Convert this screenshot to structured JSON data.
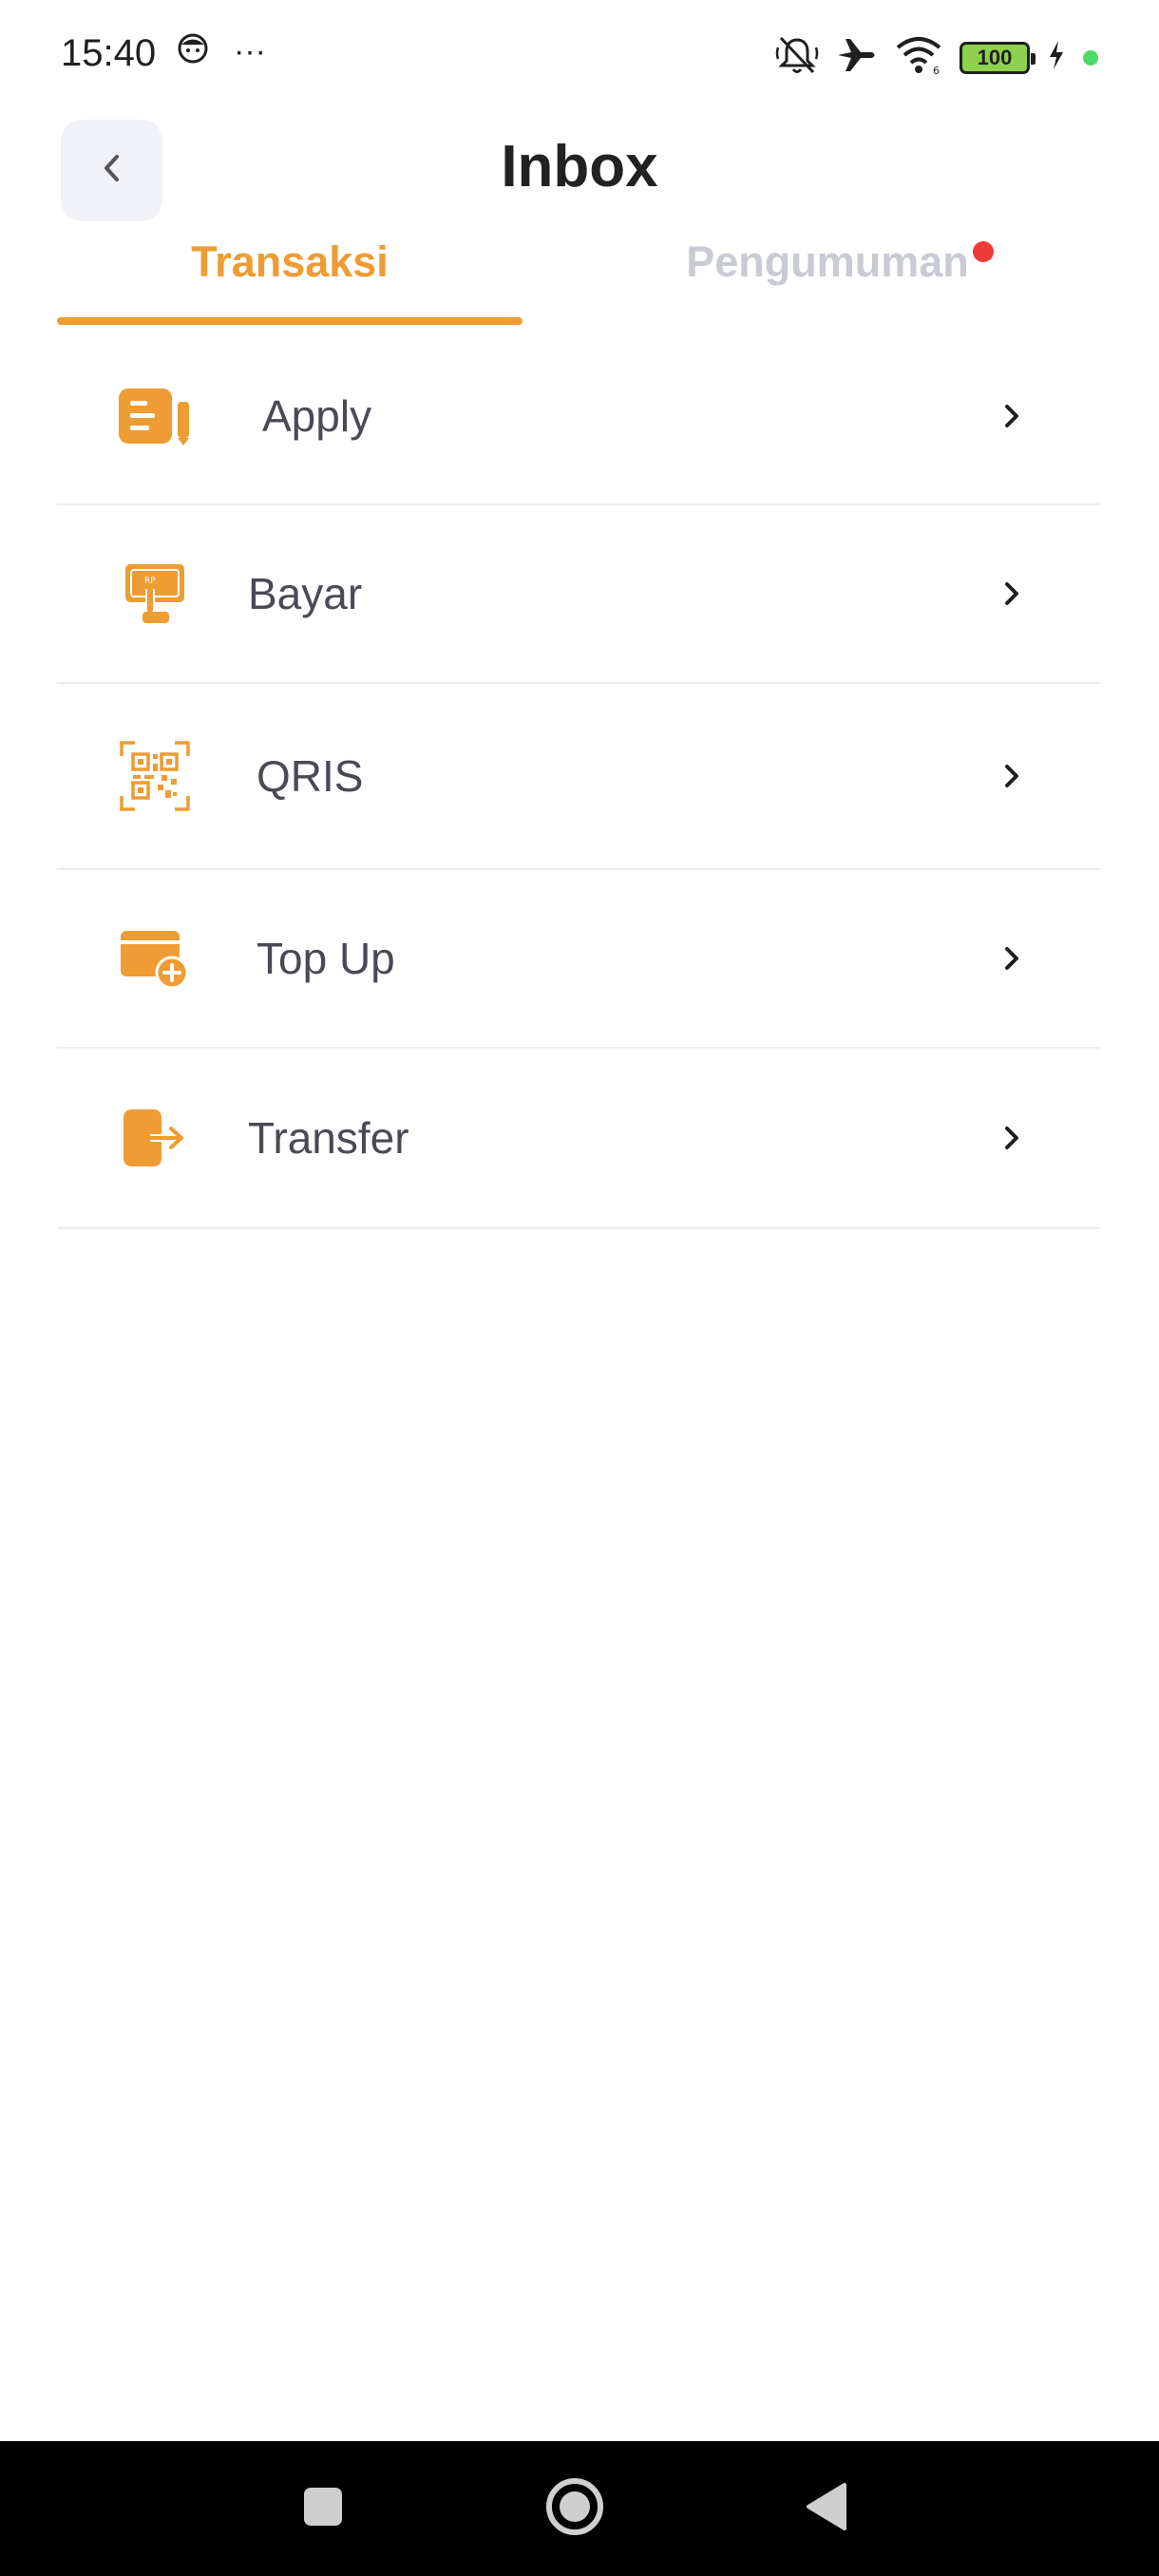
{
  "status_bar": {
    "time": "15:40",
    "more": "···",
    "battery": "100",
    "icons": [
      "face-icon",
      "mute-icon",
      "airplane-icon",
      "wifi-icon",
      "battery-icon",
      "charging-icon"
    ]
  },
  "header": {
    "title": "Inbox",
    "back_icon": "chevron-left-icon"
  },
  "tabs": [
    {
      "label": "Transaksi",
      "active": true
    },
    {
      "label": "Pengumuman",
      "active": false,
      "has_notification": true
    }
  ],
  "items": [
    {
      "label": "Apply",
      "icon": "document-pen-icon"
    },
    {
      "label": "Bayar",
      "icon": "pay-icon"
    },
    {
      "label": "QRIS",
      "icon": "qr-code-icon"
    },
    {
      "label": "Top Up",
      "icon": "wallet-add-icon"
    },
    {
      "label": "Transfer",
      "icon": "transfer-icon"
    }
  ],
  "colors": {
    "accent": "#ee9c33",
    "inactive_tab": "#c9cbd4",
    "notification": "#f03b3b"
  },
  "nav_bar": {
    "buttons": [
      "recent-apps-icon",
      "home-icon",
      "back-triangle-icon"
    ]
  }
}
